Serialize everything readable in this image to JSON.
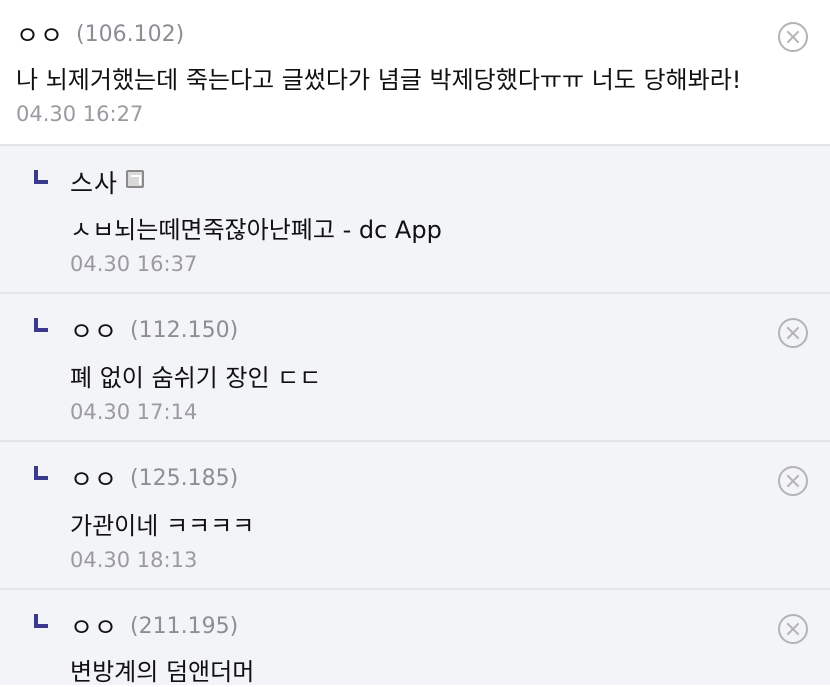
{
  "comments": [
    {
      "nick": "ㅇㅇ",
      "ip": "(106.102)",
      "text": "나 뇌제거했는데 죽는다고 글썼다가 념글 박제당했다ㅠㅠ 너도 당해봐라!",
      "time": "04.30 16:27"
    },
    {
      "nick": "스사",
      "text": "ㅅㅂ뇌는떼면죽잖아난폐고 - dc App",
      "time": "04.30 16:37"
    },
    {
      "nick": "ㅇㅇ",
      "ip": "(112.150)",
      "text": "폐 없이 숨쉬기 장인 ㄷㄷ",
      "time": "04.30 17:14"
    },
    {
      "nick": "ㅇㅇ",
      "ip": "(125.185)",
      "text": "가관이네 ㅋㅋㅋㅋ",
      "time": "04.30 18:13"
    },
    {
      "nick": "ㅇㅇ",
      "ip": "(211.195)",
      "text": "변방계의 덤앤더머"
    }
  ],
  "icons": {
    "reply": "reply-arrow-icon",
    "delete": "delete-icon",
    "badge": "fixed-nick-badge-icon"
  },
  "colors": {
    "reply_arrow": "#3a3a8c",
    "reply_bg": "#f3f4f7",
    "ip": "#8d8d94",
    "time": "#9a9aa0"
  }
}
